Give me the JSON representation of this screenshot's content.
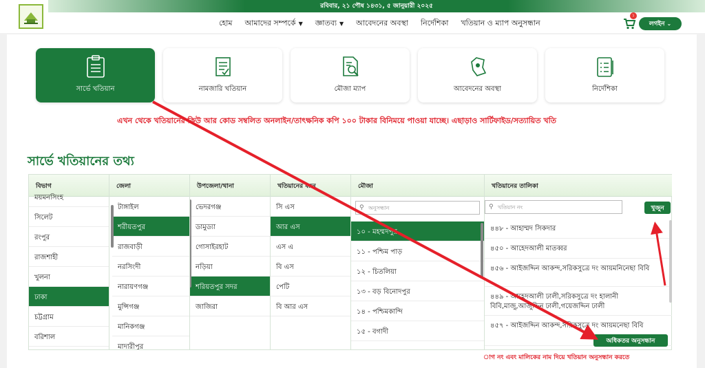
{
  "header": {
    "date": "রবিবার, ২১ পৌষ ১৪৩১, ৫ জানুয়ারী ২০২৫",
    "nav": [
      {
        "label": "হোম",
        "dropdown": false
      },
      {
        "label": "আমাদের সম্পর্কে",
        "dropdown": true
      },
      {
        "label": "জ্ঞাতব্য",
        "dropdown": true
      },
      {
        "label": "আবেদনের অবস্থা",
        "dropdown": false
      },
      {
        "label": "নির্দেশিকা",
        "dropdown": false
      },
      {
        "label": "খতিয়ান ও ম্যাপ অনুসন্ধান",
        "dropdown": false
      }
    ],
    "cart_count": "১",
    "login_label": "লগইন"
  },
  "cards": [
    {
      "label": "সার্ভে খতিয়ান",
      "active": true
    },
    {
      "label": "নামজারি খতিয়ান",
      "active": false
    },
    {
      "label": "মৌজা ম্যাপ",
      "active": false
    },
    {
      "label": "আবেদনের অবস্থা",
      "active": false
    },
    {
      "label": "নির্দেশিকা",
      "active": false
    }
  ],
  "ticker": "এখন থেকে খতিয়ানের কিউ আর কোড সম্বলিত অনলাইন/তাৎক্ষনিক কপি ১০০ টাকার বিনিময়ে পাওয়া যাচ্ছে। এছাড়াও সার্টিফাইড/সত্যায়িত খতি",
  "section_title": "সার্ভে খতিয়ানের তথ্য",
  "columns": {
    "division": {
      "header": "বিভাগ",
      "items": [
        "ময়মনসিংহ",
        "সিলেট",
        "রংপুর",
        "রাজশাহী",
        "খুলনা",
        "ঢাকা",
        "চট্টগ্রাম",
        "বরিশাল"
      ],
      "selected": "ঢাকা"
    },
    "district": {
      "header": "জেলা",
      "items": [
        "টাঙ্গাইল",
        "শরীয়তপুর",
        "রাজবাড়ী",
        "নরসিংদী",
        "নারায়ণগঞ্জ",
        "মুন্সিগঞ্জ",
        "মানিকগঞ্জ",
        "মাদারীপুর"
      ],
      "selected": "শরীয়তপুর"
    },
    "upazila": {
      "header": "উপজেলা/থানা",
      "items": [
        "ভেদরগঞ্জ",
        "ডামুড্যা",
        "গোসাইরহাট",
        "নড়িয়া",
        "শরিয়তপুর সদর",
        "জাজিরা"
      ],
      "selected": "শরিয়তপুর সদর"
    },
    "type": {
      "header": "খতিয়ানের ধরন",
      "items": [
        "সি এস",
        "আর এস",
        "এস এ",
        "বি এস",
        "পেটি",
        "বি আর এস"
      ],
      "selected": "আর এস"
    },
    "mouza": {
      "header": "মৌজা",
      "search_placeholder": "অনুসন্ধান",
      "items": [
        "১০ - মহম্মদপুর",
        "১১ - পশ্চিম পাড়",
        "১২ - চিতলিয়া",
        "১৩ - বড় বিনোদপুর",
        "১৪ - পশ্চিমকান্দি",
        "১৫ - বগাদী"
      ],
      "selected": "১০ - মহম্মদপুর"
    },
    "khatian": {
      "header": "খতিয়ানের তালিকা",
      "search_placeholder": "খতিয়ান নং",
      "search_button": "খুজুন",
      "items": [
        "৪৪৮ - আহাম্মদ সিকদার",
        "৪৫০ - আহেদআলী মাতব্বর",
        "৪৫৬ - আইজদ্দিন আকন্দ,সরিকসুত্রে দং আয়মনিনেছা বিবি",
        "৪৪৯ - আহেদআলী ঢালী,সরিকসুত্রে দং হালানী বিবি,মাজু,আজুদ্দিন ঢালী,গয়েজদ্দিন ঢালী",
        "৪৫৭ - আইজদ্দিন আকন্দ,সরিকসুত্রে দং আয়মনেছা বিবি"
      ],
      "more_button": "অধিকতর অনুসন্ধান"
    }
  },
  "hint": "াগ নং এবং মালিকের নাম দিয়ে খতিয়ান অনুসন্ধান করতে",
  "colors": {
    "brand_green": "#1c7a3c",
    "alert_red": "#e0202a"
  }
}
